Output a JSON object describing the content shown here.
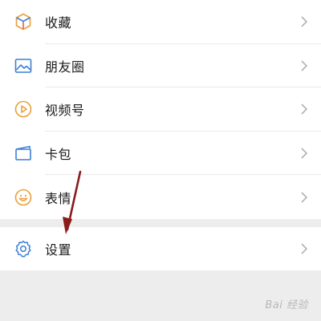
{
  "menu": {
    "items": [
      {
        "label": "收藏",
        "icon": "favorites-cube-icon"
      },
      {
        "label": "朋友圈",
        "icon": "moments-image-icon"
      },
      {
        "label": "视频号",
        "icon": "channels-play-icon"
      },
      {
        "label": "卡包",
        "icon": "card-wallet-icon"
      },
      {
        "label": "表情",
        "icon": "sticker-smile-icon"
      }
    ],
    "settings": {
      "label": "设置",
      "icon": "settings-gear-icon"
    }
  },
  "annotation": {
    "arrow_color": "#8b1a1a"
  },
  "watermark": {
    "text": "Bai 经验"
  },
  "colors": {
    "accent_blue": "#3d7fd6",
    "accent_orange": "#e8a03a",
    "background": "#ededed"
  }
}
